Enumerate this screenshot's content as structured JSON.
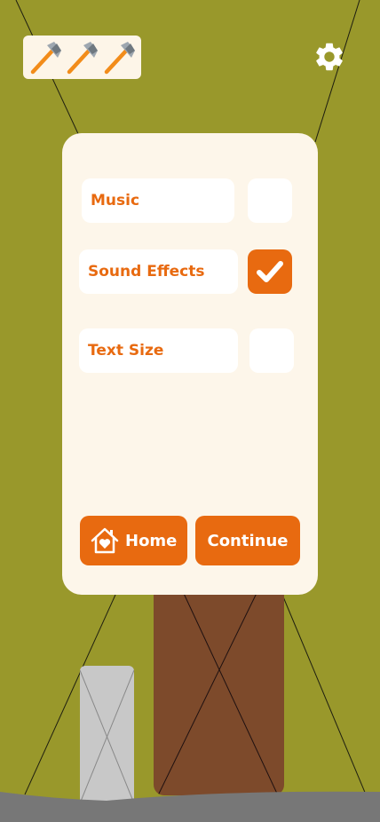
{
  "hud": {
    "lives_remaining": 3,
    "lives_icon": "axe-icon",
    "settings_icon": "gear-icon"
  },
  "settings": {
    "options": [
      {
        "label": "Music",
        "checked": false
      },
      {
        "label": "Sound Effects",
        "checked": true
      },
      {
        "label": "Text Size",
        "checked": false
      }
    ],
    "home_label": "Home",
    "home_icon": "house-heart-icon",
    "continue_label": "Continue"
  },
  "colors": {
    "background": "#99982b",
    "panel": "#fdf6ea",
    "accent": "#e86a10",
    "trunk": "#7d4a2b",
    "stump": "#c8c8c8",
    "ground": "#777777"
  }
}
